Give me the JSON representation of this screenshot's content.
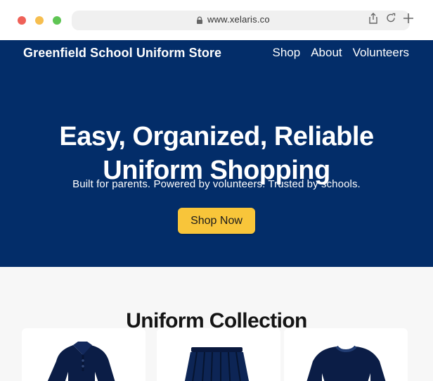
{
  "browser": {
    "url": "www.xelaris.co",
    "icons": {
      "lock": "lock-icon",
      "share": "share-icon",
      "reload": "reload-icon",
      "new_tab": "plus-icon"
    }
  },
  "site": {
    "store_name": "Greenfield School Uniform Store",
    "nav": [
      "Shop",
      "About",
      "Volunteers"
    ],
    "hero": {
      "title_line_1": "Easy, Organized, Reliable",
      "title_line_2": "Uniform Shopping",
      "subtitle": "Built for parents. Powered by volunteers. Trusted by schools.",
      "button": "Shop Now"
    },
    "collection": {
      "title": "Uniform Collection",
      "items": [
        {
          "icon": "polo-shirt-icon"
        },
        {
          "icon": "pleated-skirt-icon"
        },
        {
          "icon": "sweater-icon"
        }
      ]
    }
  },
  "colors": {
    "hero": "#032d69",
    "accent": "#f8c53a",
    "page": "#f7f7f7"
  }
}
